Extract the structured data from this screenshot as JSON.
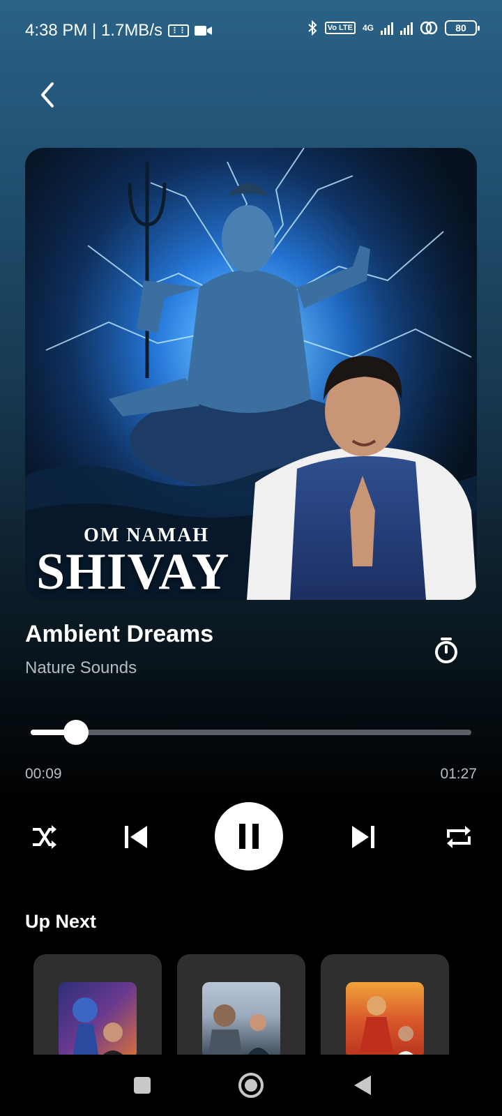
{
  "status_bar": {
    "time_speed": "4:38 PM | 1.7MB/s",
    "network": "4G",
    "volte": "Vo LTE",
    "battery": "80"
  },
  "player": {
    "cover": {
      "subtitle": "OM NAMAH",
      "title": "SHIVAY"
    },
    "track_title": "Ambient Dreams",
    "artist": "Nature Sounds",
    "progress_fraction": 0.103,
    "elapsed": "00:09",
    "total": "01:27"
  },
  "up_next": {
    "title": "Up Next",
    "items": [
      {
        "thumb_colors": [
          "#2c2f7a",
          "#d8703a"
        ]
      },
      {
        "thumb_colors": [
          "#9aa9bb",
          "#3a4756"
        ]
      },
      {
        "thumb_colors": [
          "#b8331d",
          "#f1a33a"
        ]
      }
    ]
  },
  "icons": {
    "back": "chevron-left-icon",
    "timer": "stopwatch-icon",
    "shuffle": "shuffle-icon",
    "previous": "skip-previous-icon",
    "pause": "pause-icon",
    "next": "skip-next-icon",
    "repeat": "repeat-icon"
  }
}
